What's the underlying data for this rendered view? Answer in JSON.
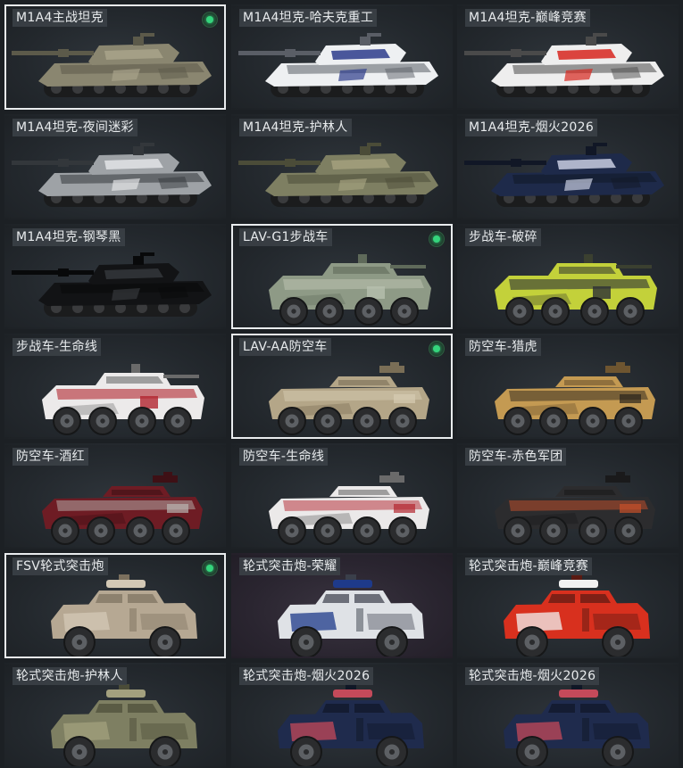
{
  "skins": [
    {
      "label": "M1A4主战坦克",
      "type": "tank",
      "body": "#8a8670",
      "accent": "#a8a38a",
      "dark": "#5c5a4a",
      "equipped": true,
      "selected": true
    },
    {
      "label": "M1A4坦克-哈夫克重工",
      "type": "tank",
      "body": "#eef0f2",
      "accent": "#2d3c8c",
      "dark": "#5a5e66",
      "equipped": false,
      "selected": false
    },
    {
      "label": "M1A4坦克-巅峰竞赛",
      "type": "tank",
      "body": "#eeeeee",
      "accent": "#d7261e",
      "dark": "#4a4a4a",
      "equipped": false,
      "selected": false
    },
    {
      "label": "M1A4坦克-夜间迷彩",
      "type": "tank",
      "body": "#9ea2a6",
      "accent": "#e2e4e6",
      "dark": "#33373b",
      "equipped": false,
      "selected": false
    },
    {
      "label": "M1A4坦克-护林人",
      "type": "tank",
      "body": "#7e7f62",
      "accent": "#a3a07e",
      "dark": "#4b4c38",
      "equipped": false,
      "selected": false
    },
    {
      "label": "M1A4坦克-烟火2026",
      "type": "tank",
      "body": "#1e2a4a",
      "accent": "#c8cde0",
      "dark": "#111726",
      "equipped": false,
      "selected": false
    },
    {
      "label": "M1A4坦克-钢琴黑",
      "type": "tank",
      "body": "#121315",
      "accent": "#34373b",
      "dark": "#08090a",
      "equipped": false,
      "selected": false
    },
    {
      "label": "LAV-G1步战车",
      "type": "ifv",
      "body": "#8e9a86",
      "accent": "#b7bfae",
      "dark": "#5f6a5a",
      "equipped": true,
      "selected": true
    },
    {
      "label": "步战车-破碎",
      "type": "ifv",
      "body": "#c3d13a",
      "accent": "#2c3036",
      "dark": "#3b4030",
      "equipped": false,
      "selected": false
    },
    {
      "label": "步战车-生命线",
      "type": "ifv",
      "body": "#eceaea",
      "accent": "#b3262f",
      "dark": "#6a6a6a",
      "equipped": false,
      "selected": false
    },
    {
      "label": "LAV-AA防空车",
      "type": "aa",
      "body": "#b4a688",
      "accent": "#d6ccb2",
      "dark": "#7a6e56",
      "equipped": true,
      "selected": true
    },
    {
      "label": "防空车-猎虎",
      "type": "aa",
      "body": "#c49a52",
      "accent": "#2a241c",
      "dark": "#6e5530",
      "equipped": false,
      "selected": false
    },
    {
      "label": "防空车-酒红",
      "type": "aa",
      "body": "#6e1c24",
      "accent": "#b8b4b0",
      "dark": "#3e1015",
      "equipped": false,
      "selected": false
    },
    {
      "label": "防空车-生命线",
      "type": "aa",
      "body": "#ebe9e9",
      "accent": "#b3262f",
      "dark": "#6a6a6a",
      "equipped": false,
      "selected": false
    },
    {
      "label": "防空车-赤色军团",
      "type": "aa",
      "body": "#2c2c2e",
      "accent": "#c8502a",
      "dark": "#1a1a1b",
      "equipped": false,
      "selected": false
    },
    {
      "label": "FSV轮式突击炮",
      "type": "fsv",
      "body": "#b6a893",
      "accent": "#d3c8b5",
      "dark": "#7c705e",
      "equipped": true,
      "selected": true
    },
    {
      "label": "轮式突击炮-荣耀",
      "type": "fsv",
      "body": "#dfe2e6",
      "accent": "#1e3a8a",
      "dark": "#3a3f4a",
      "equipped": false,
      "selected": false,
      "purple": true
    },
    {
      "label": "轮式突击炮-巅峰竞赛",
      "type": "fsv",
      "body": "#d8301e",
      "accent": "#f1f1f1",
      "dark": "#5a1a12",
      "equipped": false,
      "selected": false
    },
    {
      "label": "轮式突击炮-护林人",
      "type": "fsv",
      "body": "#7e7f62",
      "accent": "#a3a07e",
      "dark": "#4b4c38",
      "equipped": false,
      "selected": false
    },
    {
      "label": "轮式突击炮-烟火2026",
      "type": "fsv",
      "body": "#1f2b4d",
      "accent": "#c44a5a",
      "dark": "#101726",
      "equipped": false,
      "selected": false
    },
    {
      "label": "轮式突击炮-烟火2026",
      "type": "fsv",
      "body": "#1f2b4d",
      "accent": "#c44a5a",
      "dark": "#101726",
      "equipped": false,
      "selected": false
    }
  ]
}
